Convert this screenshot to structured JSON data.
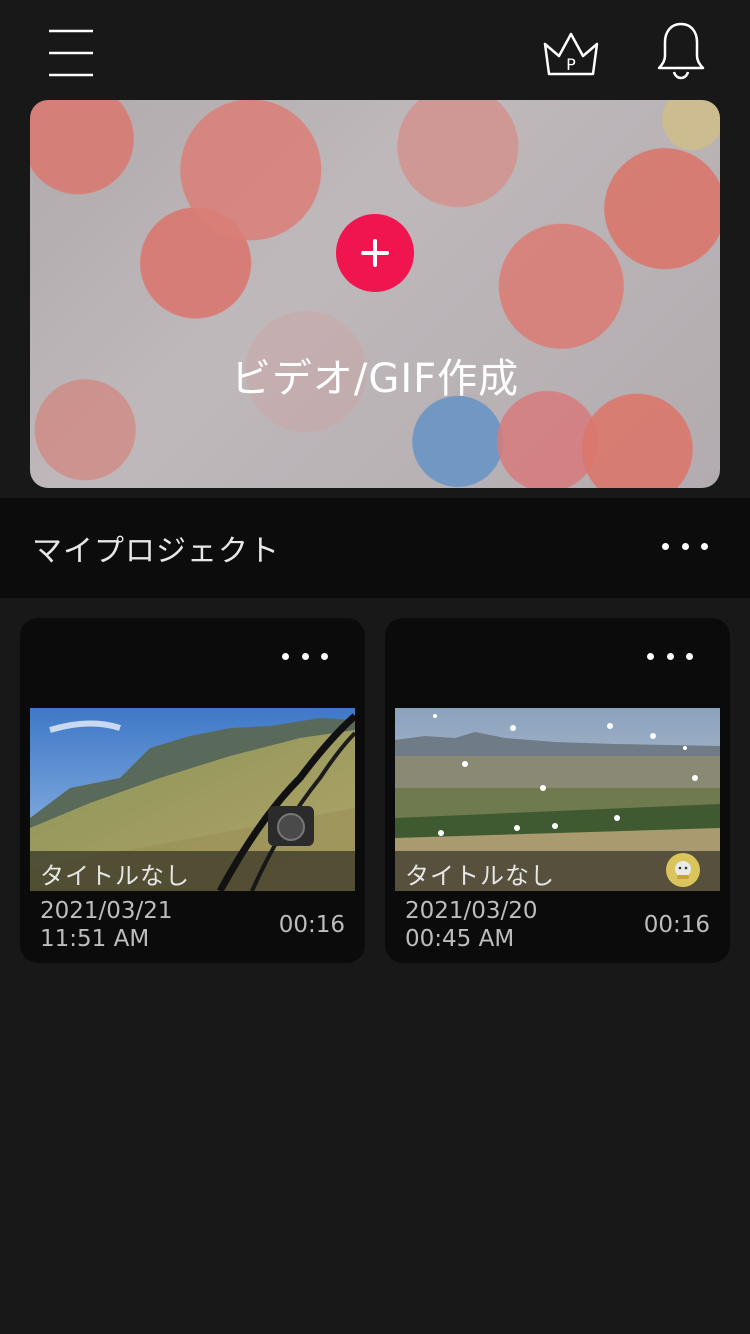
{
  "header": {
    "menu_icon": "hamburger-menu-icon",
    "premium_icon": "crown-icon",
    "premium_letter": "P",
    "notification_icon": "bell-icon"
  },
  "hero": {
    "label": "ビデオ/GIF作成",
    "add_icon": "plus-icon",
    "accent": "#f0144f"
  },
  "projects_section": {
    "title": "マイプロジェクト",
    "more_icon": "more-dots-icon"
  },
  "projects": [
    {
      "title": "タイトルなし",
      "date": "2021/03/21",
      "time": "11:51 AM",
      "duration": "00:16"
    },
    {
      "title": "タイトルなし",
      "date": "2021/03/20",
      "time": "00:45 AM",
      "duration": "00:16"
    }
  ],
  "colors": {
    "background": "#181818",
    "section_background": "#0c0c0c",
    "card_background": "#0b0b0b",
    "text": "#ffffff",
    "muted_text": "#bdbdbd"
  }
}
